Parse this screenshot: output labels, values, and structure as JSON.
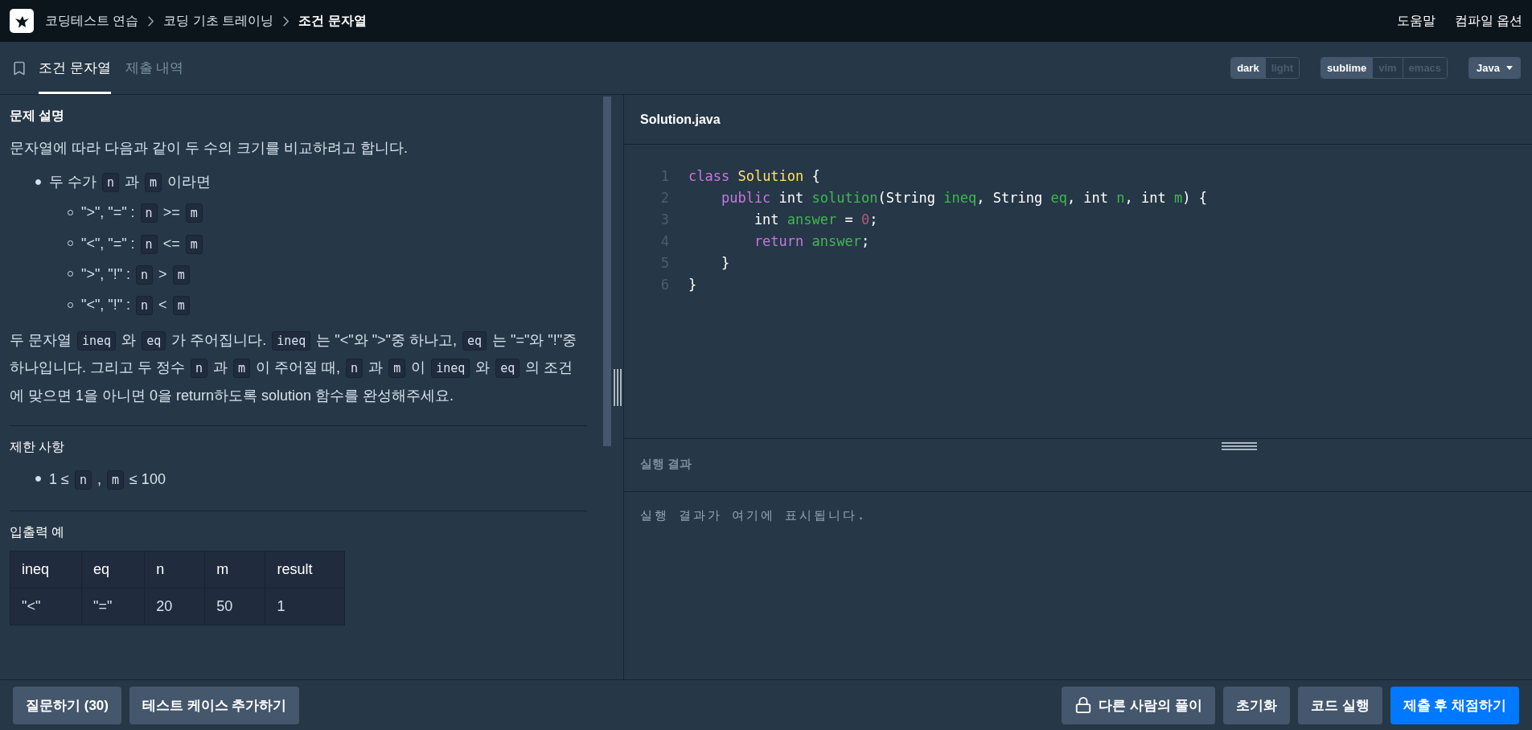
{
  "breadcrumbs": [
    "코딩테스트 연습",
    "코딩 기초 트레이닝"
  ],
  "page_title": "조건 문자열",
  "header_links": [
    "도움말",
    "컴파일 옵션"
  ],
  "tabs": [
    {
      "label": "조건 문자열",
      "selected": true
    },
    {
      "label": "제출 내역",
      "selected": false
    }
  ],
  "theme_options": [
    {
      "label": "dark",
      "selected": true
    },
    {
      "label": "light",
      "selected": false
    }
  ],
  "keymap_options": [
    {
      "label": "sublime",
      "selected": true
    },
    {
      "label": "vim",
      "selected": false
    },
    {
      "label": "emacs",
      "selected": false
    }
  ],
  "language": "Java",
  "description": {
    "heading": "문제 설명",
    "blocks": [
      {
        "kind": "paragraph",
        "segments": [
          {
            "text": "문자열에 따라 다음과 같이 두 수의 크기를 비교하려고 합니다."
          }
        ]
      },
      {
        "kind": "list",
        "items": [
          {
            "segments": [
              {
                "text": "두 수가 "
              },
              {
                "code": "n"
              },
              {
                "text": " 과 "
              },
              {
                "code": "m"
              },
              {
                "text": " 이라면"
              }
            ],
            "children": [
              {
                "segments": [
                  {
                    "text": "\">\", \"=\" : "
                  },
                  {
                    "code": "n"
                  },
                  {
                    "text": " >= "
                  },
                  {
                    "code": "m"
                  }
                ]
              },
              {
                "segments": [
                  {
                    "text": "\"<\", \"=\" : "
                  },
                  {
                    "code": "n"
                  },
                  {
                    "text": " <= "
                  },
                  {
                    "code": "m"
                  }
                ]
              },
              {
                "segments": [
                  {
                    "text": "\">\", \"!\" : "
                  },
                  {
                    "code": "n"
                  },
                  {
                    "text": " > "
                  },
                  {
                    "code": "m"
                  }
                ]
              },
              {
                "segments": [
                  {
                    "text": "\"<\", \"!\" : "
                  },
                  {
                    "code": "n"
                  },
                  {
                    "text": " < "
                  },
                  {
                    "code": "m"
                  }
                ]
              }
            ]
          }
        ]
      },
      {
        "kind": "paragraph",
        "segments": [
          {
            "text": "두 문자열 "
          },
          {
            "code": "ineq"
          },
          {
            "text": " 와 "
          },
          {
            "code": "eq"
          },
          {
            "text": " 가 주어집니다. "
          },
          {
            "code": "ineq"
          },
          {
            "text": " 는 \"<\"와 \">\"중 하나고, "
          },
          {
            "code": "eq"
          },
          {
            "text": " 는 \"=\"와 \"!\"중 하나입니다. 그리고 두 정수 "
          },
          {
            "code": "n"
          },
          {
            "text": " 과 "
          },
          {
            "code": "m"
          },
          {
            "text": " 이 주어질 때, "
          },
          {
            "code": "n"
          },
          {
            "text": " 과 "
          },
          {
            "code": "m"
          },
          {
            "text": " 이 "
          },
          {
            "code": "ineq"
          },
          {
            "text": " 와 "
          },
          {
            "code": "eq"
          },
          {
            "text": " 의 조건에 맞으면 1을 아니면 0을 return하도록 solution 함수를 완성해주세요."
          }
        ]
      }
    ]
  },
  "constraints": {
    "heading": "제한 사항",
    "blocks": [
      {
        "kind": "list",
        "items": [
          {
            "segments": [
              {
                "text": "1 ≤ "
              },
              {
                "code": "n"
              },
              {
                "text": " , "
              },
              {
                "code": "m"
              },
              {
                "text": " ≤ 100"
              }
            ]
          }
        ]
      }
    ]
  },
  "examples": {
    "heading": "입출력 예",
    "columns": [
      "ineq",
      "eq",
      "n",
      "m",
      "result"
    ],
    "rows": [
      [
        "\"<\"",
        "\"=\"",
        "20",
        "50",
        "1"
      ]
    ]
  },
  "editor": {
    "filename": "Solution.java",
    "lines": [
      {
        "number": "1",
        "tokens": [
          {
            "kind": "keyword",
            "text": "class "
          },
          {
            "kind": "class",
            "text": "Solution"
          },
          {
            "kind": "plain",
            "text": " {"
          }
        ]
      },
      {
        "number": "2",
        "tokens": [
          {
            "kind": "keyword",
            "text": "    public"
          },
          {
            "kind": "plain",
            "text": " int "
          },
          {
            "kind": "name",
            "text": "solution"
          },
          {
            "kind": "plain",
            "text": "(String "
          },
          {
            "kind": "name",
            "text": "ineq"
          },
          {
            "kind": "plain",
            "text": ", String "
          },
          {
            "kind": "name",
            "text": "eq"
          },
          {
            "kind": "plain",
            "text": ", int "
          },
          {
            "kind": "name",
            "text": "n"
          },
          {
            "kind": "plain",
            "text": ", int "
          },
          {
            "kind": "name",
            "text": "m"
          },
          {
            "kind": "plain",
            "text": ") {"
          }
        ]
      },
      {
        "number": "3",
        "tokens": [
          {
            "kind": "plain",
            "text": "        int "
          },
          {
            "kind": "name",
            "text": "answer"
          },
          {
            "kind": "plain",
            "text": " = "
          },
          {
            "kind": "number",
            "text": "0"
          },
          {
            "kind": "plain",
            "text": ";"
          }
        ]
      },
      {
        "number": "4",
        "tokens": [
          {
            "kind": "keyword",
            "text": "        return"
          },
          {
            "kind": "name",
            "text": " answer"
          },
          {
            "kind": "plain",
            "text": ";"
          }
        ]
      },
      {
        "number": "5",
        "tokens": [
          {
            "kind": "plain",
            "text": "    }"
          }
        ]
      },
      {
        "number": "6",
        "tokens": [
          {
            "kind": "plain",
            "text": "}"
          }
        ]
      }
    ]
  },
  "result": {
    "heading": "실행 결과",
    "placeholder": "실행 결과가 여기에 표시됩니다."
  },
  "left_buttons": [
    "질문하기 (30)",
    "테스트 케이스 추가하기"
  ],
  "right_buttons": [
    {
      "label": "다른 사람의 풀이",
      "kind": "locked"
    },
    {
      "label": "초기화",
      "kind": "plain"
    },
    {
      "label": "코드 실행",
      "kind": "plain"
    },
    {
      "label": "제출 후 채점하기",
      "kind": "primary"
    }
  ]
}
